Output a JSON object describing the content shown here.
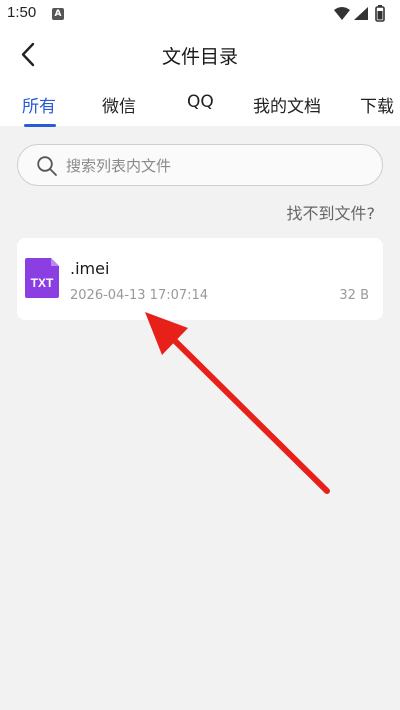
{
  "status_bar": {
    "time": "1:50",
    "notification_icon": "A"
  },
  "header": {
    "title": "文件目录"
  },
  "tabs": [
    {
      "label": "所有",
      "active": true
    },
    {
      "label": "微信",
      "active": false
    },
    {
      "label": "QQ",
      "active": false
    },
    {
      "label": "我的文档",
      "active": false
    },
    {
      "label": "下载",
      "active": false
    }
  ],
  "search": {
    "placeholder": "搜索列表内文件",
    "value": ""
  },
  "not_found_link": "找不到文件?",
  "files": [
    {
      "name": ".imei",
      "date": "2026-04-13 17:07:14",
      "size": "32 B",
      "type_label": "TXT",
      "icon_color": "#8b3fe3"
    }
  ],
  "colors": {
    "accent": "#2a5bd7",
    "annotation_arrow": "#e8201a"
  }
}
